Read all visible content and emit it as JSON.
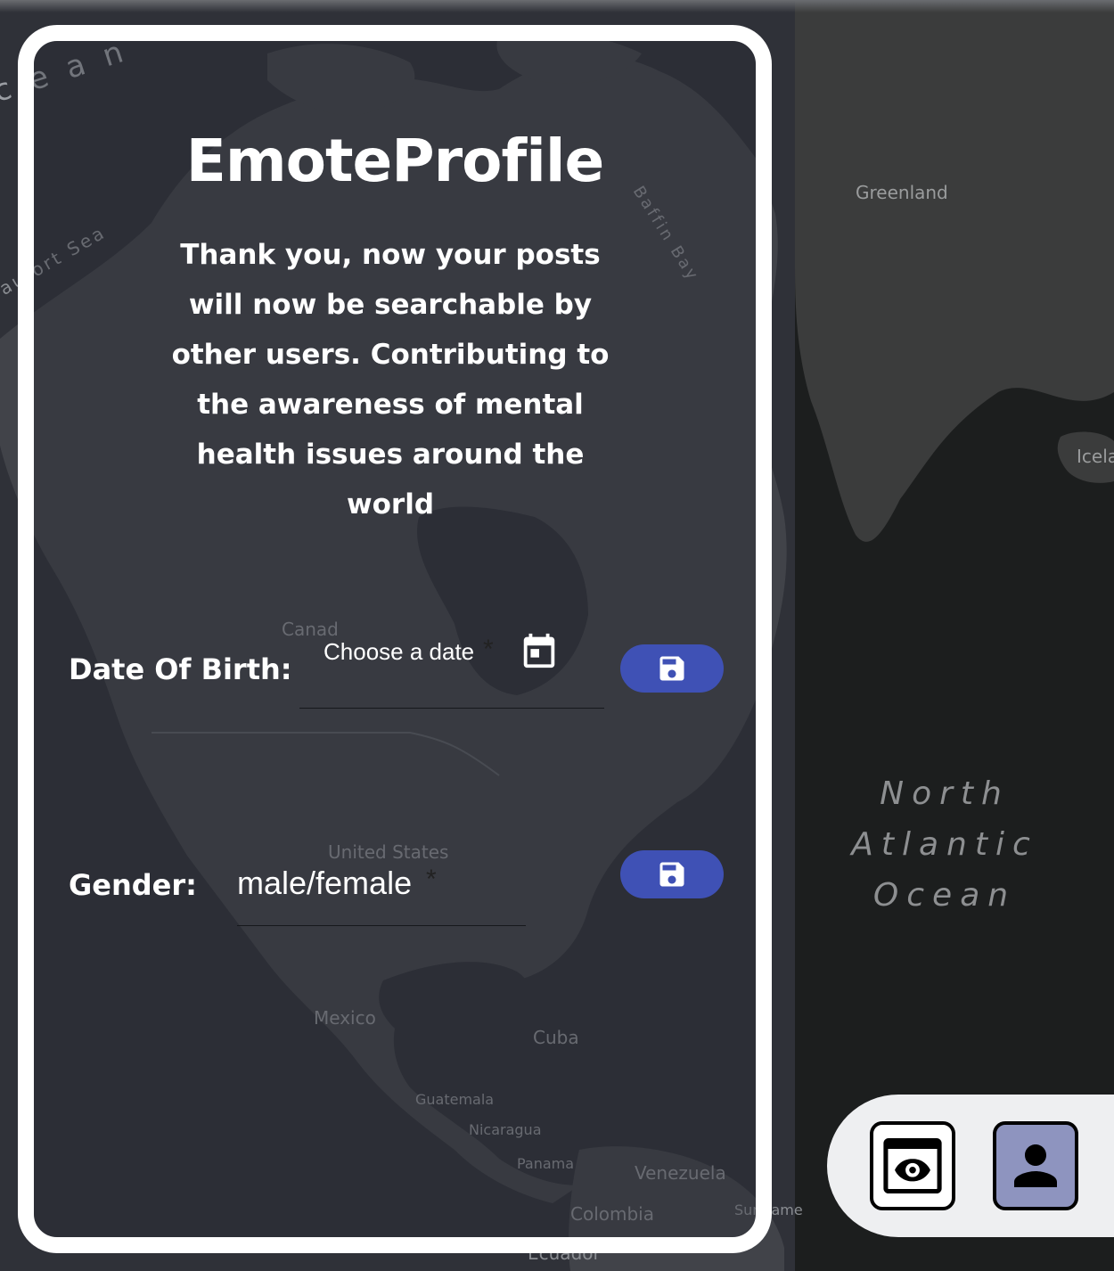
{
  "app": {
    "title": "EmoteProfile",
    "message": "Thank you, now your posts will now be searchable by other users. Contributing to the awareness of mental health issues around the world"
  },
  "form": {
    "dob": {
      "label": "Date Of Birth:",
      "placeholder": "Choose a date",
      "required_mark": "*",
      "value": ""
    },
    "gender": {
      "label": "Gender:",
      "placeholder": "male/female",
      "required_mark": "*",
      "value": ""
    },
    "save_icon": "floppy-disk-icon",
    "calendar_icon": "calendar-icon"
  },
  "map_labels": {
    "ocean_partial": "c e a n",
    "beaufort_sea": "aufort Sea",
    "baffin_bay": "Baffin Bay",
    "greenland": "Greenland",
    "iceland": "Icela",
    "canada": "Canad",
    "united_states": "United States",
    "mexico": "Mexico",
    "cuba": "Cuba",
    "guatemala": "Guatemala",
    "nicaragua": "Nicaragua",
    "panama": "Panama",
    "venezuela": "Venezuela",
    "colombia": "Colombia",
    "suriname": "Suriname",
    "ecuador": "Ecuador",
    "north_atlantic_ocean": [
      "North",
      "Atlantic",
      "Ocean"
    ]
  },
  "bottom_nav": {
    "view_icon": "eye-icon",
    "profile_icon": "person-icon"
  },
  "colors": {
    "accent": "#3f51b5",
    "panel_border": "#ffffff",
    "profile_button_bg": "#8e94bf",
    "nav_bar_bg": "#eeeff1",
    "map_land": "#3f4147",
    "map_water": "#2e3038"
  }
}
